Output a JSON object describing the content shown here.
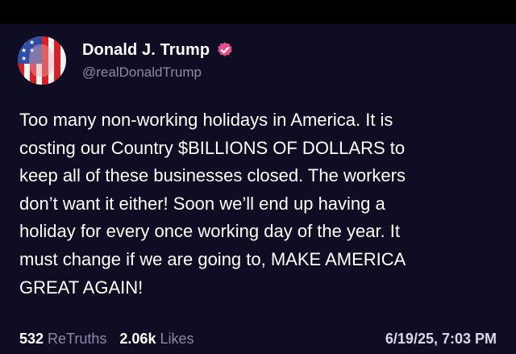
{
  "post": {
    "display_name": "Donald J. Trump",
    "handle": "@realDonaldTrump",
    "verified_icon": "verified-badge-icon",
    "verified_color": "#e84d8a",
    "body_lines": [
      "Too many non-working holidays in America. It is",
      "costing our Country $BILLIONS OF DOLLARS to",
      "keep all of these businesses closed. The workers",
      "don’t want it either! Soon we’ll end up having a",
      "holiday for every once working day of the year. It",
      "must change if we are going to, MAKE AMERICA",
      "GREAT AGAIN!"
    ],
    "stats": {
      "retruths_count": "532",
      "retruths_label": "ReTruths",
      "likes_count": "2.06k",
      "likes_label": "Likes"
    },
    "timestamp": "6/19/25, 7:03 PM"
  },
  "colors": {
    "background": "#0f0d24",
    "text": "#ffffff",
    "muted": "#8b8aa8"
  }
}
